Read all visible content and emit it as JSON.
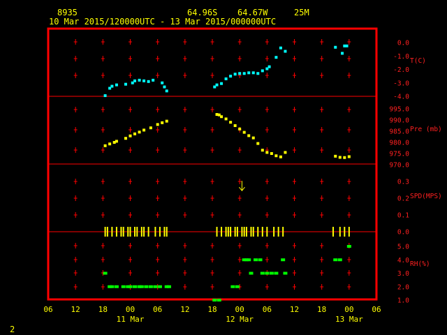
{
  "header": {
    "station": "8935",
    "lat": "64.96S",
    "lon": "64.67W",
    "elev": "25M",
    "range": "10 Mar 2015/120000UTC - 13 Mar 2015/000000UTC"
  },
  "footer": {
    "page_number": "2"
  },
  "colors": {
    "frame": "#ff0000",
    "text": "#ffff00",
    "temp": "#00ffff",
    "pressure": "#ffff00",
    "speed": "#ffff00",
    "rh": "#00ff00"
  },
  "chart_data": {
    "type": "scatter",
    "x_unit": "hours since 10 Mar 2015 06 UTC",
    "x_range": [
      0,
      72
    ],
    "x_ticks": [
      {
        "h": 0,
        "label": "06"
      },
      {
        "h": 6,
        "label": "12"
      },
      {
        "h": 12,
        "label": "18"
      },
      {
        "h": 18,
        "label": "00"
      },
      {
        "h": 24,
        "label": "06"
      },
      {
        "h": 30,
        "label": "12"
      },
      {
        "h": 36,
        "label": "18"
      },
      {
        "h": 42,
        "label": "00"
      },
      {
        "h": 48,
        "label": "06"
      },
      {
        "h": 54,
        "label": "12"
      },
      {
        "h": 60,
        "label": "18"
      },
      {
        "h": 66,
        "label": "00"
      },
      {
        "h": 72,
        "label": "06"
      }
    ],
    "date_labels": [
      {
        "h": 18,
        "label": "11 Mar"
      },
      {
        "h": 42,
        "label": "12 Mar"
      },
      {
        "h": 66,
        "label": "13 Mar"
      }
    ],
    "panels": [
      {
        "key": "temp",
        "label": "T(C)",
        "ylim": [
          -4.0,
          0.5
        ],
        "ticks": [
          "0.0",
          "-1.0",
          "-2.0",
          "-3.0",
          "-4.0"
        ],
        "tick_values": [
          0,
          -1,
          -2,
          -3,
          -4
        ],
        "values": [
          [
            12.5,
            -3.95
          ],
          [
            13.5,
            -3.4
          ],
          [
            14,
            -3.25
          ],
          [
            15,
            -3.15
          ],
          [
            17,
            -3.1
          ],
          [
            18.5,
            -3.0
          ],
          [
            19,
            -2.85
          ],
          [
            20,
            -2.8
          ],
          [
            21,
            -2.85
          ],
          [
            22,
            -2.9
          ],
          [
            23,
            -2.8
          ],
          [
            25,
            -3.0
          ],
          [
            25.5,
            -3.3
          ],
          [
            26,
            -3.6
          ],
          [
            36.5,
            -3.3
          ],
          [
            37,
            -3.15
          ],
          [
            38,
            -3.05
          ],
          [
            39,
            -2.7
          ],
          [
            40,
            -2.5
          ],
          [
            41,
            -2.35
          ],
          [
            42,
            -2.3
          ],
          [
            43,
            -2.3
          ],
          [
            44,
            -2.25
          ],
          [
            45,
            -2.25
          ],
          [
            46,
            -2.3
          ],
          [
            47,
            -2.1
          ],
          [
            48,
            -1.95
          ],
          [
            48.5,
            -1.8
          ],
          [
            50,
            -1.1
          ],
          [
            51,
            -0.4
          ],
          [
            52,
            -0.65
          ],
          [
            63,
            -0.35
          ],
          [
            65,
            -0.25
          ],
          [
            64.5,
            -0.8
          ],
          [
            65.5,
            -0.25
          ]
        ]
      },
      {
        "key": "pressure",
        "label": "Pre (mb)",
        "ylim": [
          970.0,
          996.0
        ],
        "ticks": [
          "995.0",
          "990.0",
          "985.0",
          "980.0",
          "975.0",
          "970.0"
        ],
        "tick_values": [
          995,
          990,
          985,
          980,
          975,
          970
        ],
        "values": [
          [
            12.5,
            978.5
          ],
          [
            13.5,
            979.3
          ],
          [
            14.5,
            980.0
          ],
          [
            15,
            980.5
          ],
          [
            17,
            981.8
          ],
          [
            18,
            982.9
          ],
          [
            19,
            983.8
          ],
          [
            20,
            984.6
          ],
          [
            21,
            985.5
          ],
          [
            22.5,
            986.5
          ],
          [
            24,
            988.0
          ],
          [
            25,
            988.8
          ],
          [
            26,
            989.5
          ],
          [
            37,
            992.5
          ],
          [
            37.5,
            992.3
          ],
          [
            38,
            991.5
          ],
          [
            39,
            990.5
          ],
          [
            40,
            989.0
          ],
          [
            41,
            987.5
          ],
          [
            42,
            986.0
          ],
          [
            43,
            984.5
          ],
          [
            44,
            983.0
          ],
          [
            45,
            982.0
          ],
          [
            46,
            979.5
          ],
          [
            47,
            976.5
          ],
          [
            48,
            975.5
          ],
          [
            49,
            975.0
          ],
          [
            50,
            974.0
          ],
          [
            51,
            973.5
          ],
          [
            52,
            975.5
          ],
          [
            63,
            973.8
          ],
          [
            64,
            973.3
          ],
          [
            65,
            973.2
          ],
          [
            66,
            973.6
          ]
        ]
      },
      {
        "key": "speed",
        "label": "SPD(MPS)",
        "ylim": [
          0.0,
          0.32
        ],
        "ticks": [
          "0.3",
          "0.2",
          "0.1",
          "0.0"
        ],
        "tick_values": [
          0.3,
          0.2,
          0.1,
          0
        ],
        "values": [
          [
            12.5,
            0
          ],
          [
            13,
            0
          ],
          [
            14,
            0
          ],
          [
            15,
            0
          ],
          [
            16,
            0
          ],
          [
            16.5,
            0
          ],
          [
            17.5,
            0
          ],
          [
            18,
            0
          ],
          [
            19,
            0
          ],
          [
            19.5,
            0
          ],
          [
            20.5,
            0
          ],
          [
            21,
            0
          ],
          [
            22,
            0
          ],
          [
            23.5,
            0
          ],
          [
            24.5,
            0
          ],
          [
            25.5,
            0
          ],
          [
            26,
            0
          ],
          [
            37,
            0
          ],
          [
            38,
            0
          ],
          [
            39,
            0
          ],
          [
            39.5,
            0
          ],
          [
            40,
            0
          ],
          [
            41,
            0
          ],
          [
            41.5,
            0
          ],
          [
            42.5,
            0
          ],
          [
            43,
            0
          ],
          [
            43.5,
            0
          ],
          [
            44.5,
            0
          ],
          [
            45,
            0
          ],
          [
            46,
            0
          ],
          [
            47,
            0
          ],
          [
            48,
            0
          ],
          [
            49.5,
            0
          ],
          [
            50.5,
            0
          ],
          [
            51.5,
            0
          ],
          [
            62.5,
            0
          ],
          [
            64,
            0
          ],
          [
            65,
            0
          ],
          [
            66,
            0
          ]
        ],
        "arrow": {
          "h": 42.5,
          "value": 0.27
        }
      },
      {
        "key": "rh",
        "label": "RH(%)",
        "ylim": [
          1.0,
          5.5
        ],
        "ticks": [
          "5.0",
          "4.0",
          "3.0",
          "2.0",
          "1.0"
        ],
        "tick_values": [
          5,
          4,
          3,
          2,
          1
        ],
        "values": [
          [
            12.5,
            3.0
          ],
          [
            13.5,
            2.0
          ],
          [
            14,
            2.0
          ],
          [
            15,
            2.0
          ],
          [
            16.5,
            2.0
          ],
          [
            17.5,
            2.0
          ],
          [
            18,
            2.0
          ],
          [
            19,
            2.0
          ],
          [
            20,
            2.0
          ],
          [
            20.5,
            2.0
          ],
          [
            21.5,
            2.0
          ],
          [
            22.5,
            2.0
          ],
          [
            23.5,
            2.0
          ],
          [
            24.5,
            2.0
          ],
          [
            26,
            2.0
          ],
          [
            26.5,
            2.0
          ],
          [
            36.5,
            1.0
          ],
          [
            37.5,
            1.0
          ],
          [
            40.5,
            2.0
          ],
          [
            41.5,
            2.0
          ],
          [
            43,
            4.0
          ],
          [
            43.5,
            4.0
          ],
          [
            44,
            4.0
          ],
          [
            44.5,
            3.0
          ],
          [
            45.5,
            4.0
          ],
          [
            46.5,
            4.0
          ],
          [
            47,
            3.0
          ],
          [
            48,
            3.0
          ],
          [
            49,
            3.0
          ],
          [
            50,
            3.0
          ],
          [
            51.5,
            4.0
          ],
          [
            52,
            3.0
          ],
          [
            63,
            4.0
          ],
          [
            64,
            4.0
          ],
          [
            66,
            5.0
          ]
        ]
      }
    ]
  }
}
